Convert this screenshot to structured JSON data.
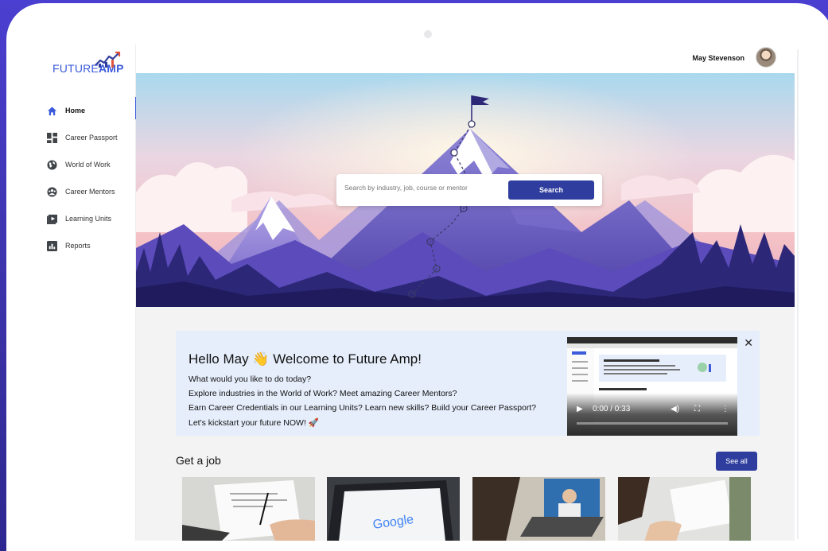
{
  "brand": {
    "logo_part1": "FUTURE",
    "logo_part2": "AMP"
  },
  "sidebar": {
    "items": [
      {
        "label": "Home",
        "icon": "home-icon",
        "active": true
      },
      {
        "label": "Career Passport",
        "icon": "grid-icon"
      },
      {
        "label": "World of Work",
        "icon": "globe-icon"
      },
      {
        "label": "Career Mentors",
        "icon": "mentor-icon"
      },
      {
        "label": "Learning Units",
        "icon": "play-icon"
      },
      {
        "label": "Reports",
        "icon": "chart-icon"
      }
    ]
  },
  "topbar": {
    "user_name": "May Stevenson"
  },
  "hero": {
    "search_placeholder": "Search by industry, job, course or mentor",
    "search_label": "Search"
  },
  "welcome": {
    "title": "Hello May 👋 Welcome to Future Amp!",
    "lines": [
      "What would you like to do today?",
      "Explore industries in the World of Work? Meet amazing Career Mentors?",
      "Earn Career Credentials in our Learning Units? Learn new skills? Build your Career Passport?",
      "Let's kickstart your future NOW! 🚀"
    ],
    "close_label": "✕",
    "video_time": "0:00 / 0:33"
  },
  "jobs": {
    "title": "Get a job",
    "see_all_label": "See all"
  },
  "colors": {
    "brand_blue": "#2f3e9e",
    "accent_blue": "#3b5bdb"
  }
}
